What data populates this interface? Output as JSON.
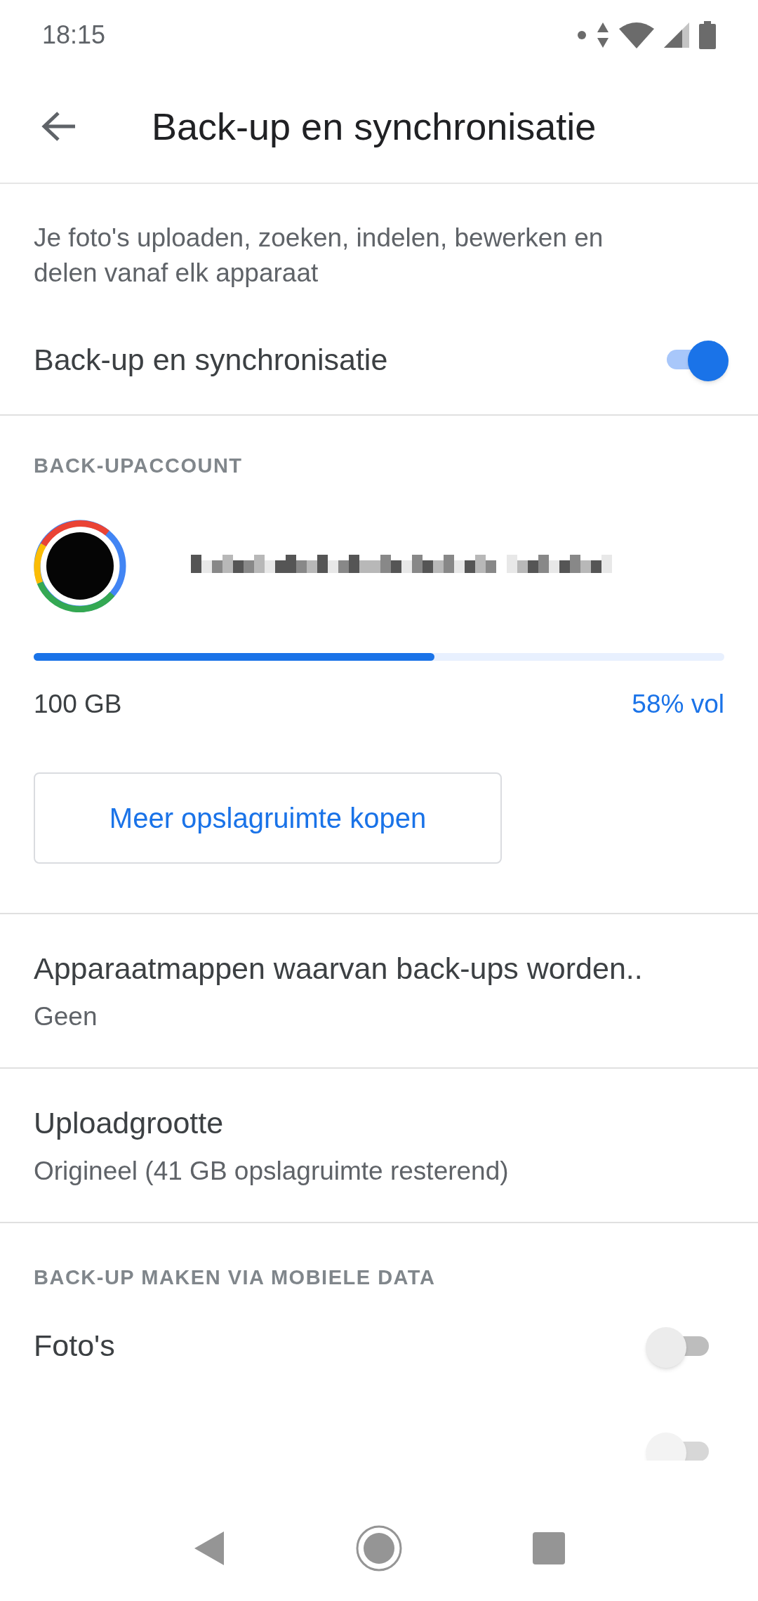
{
  "status_bar": {
    "time": "18:15"
  },
  "app_bar": {
    "title": "Back-up en synchronisatie"
  },
  "description": "Je foto's uploaden, zoeken, indelen, bewerken en delen vanaf elk apparaat",
  "backup_toggle": {
    "label": "Back-up en synchronisatie",
    "on": true
  },
  "account_section": {
    "header": "BACK-UPACCOUNT",
    "storage": {
      "level": 0.58,
      "total": "100 GB",
      "used": "58% vol"
    },
    "buy_button": "Meer opslagruimte kopen"
  },
  "settings": [
    {
      "title": "Apparaatmappen waarvan back-ups worden..",
      "subtitle": "Geen"
    },
    {
      "title": "Uploadgrootte",
      "subtitle": "Origineel (41 GB opslagruimte resterend)"
    }
  ],
  "mobile_data": {
    "header": "BACK-UP MAKEN VIA MOBIELE DATA",
    "items": [
      {
        "label": "Foto's",
        "on": false
      },
      {
        "on": false
      }
    ]
  }
}
